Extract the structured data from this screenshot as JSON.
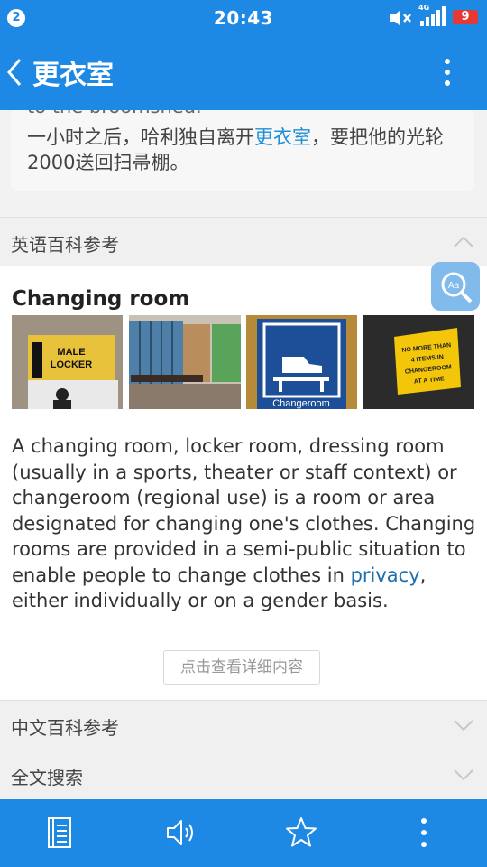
{
  "status_bar": {
    "notification_count": "2",
    "time": "20:43",
    "network": "4G",
    "battery": "9"
  },
  "header": {
    "title": "更衣室"
  },
  "example": {
    "cut_text": "to the broomshed.",
    "sentence_before": "一小时之后，哈利独自离开",
    "sentence_highlight": "更衣室",
    "sentence_after": "，要把他的光轮2000送回扫帚棚。"
  },
  "sections": {
    "english_encyclopedia": "英语百科参考",
    "chinese_encyclopedia": "中文百科参考",
    "full_text_search": "全文搜索"
  },
  "encyclopedia": {
    "heading": "Changing room",
    "images": [
      {
        "caption_line1": "MALE",
        "caption_line2": "LOCKER"
      },
      {
        "caption": ""
      },
      {
        "caption": "Changeroom"
      },
      {
        "caption": "NO MORE THAN 4 ITEMS IN CHANGEROOM AT A TIME"
      }
    ],
    "text_before_link": "A changing room, locker room, dressing room (usually in a sports, theater or staff context) or changeroom (regional use) is a room or area designated for changing one's clothes. Changing rooms are provided in a semi-public situation to enable people to change clothes in ",
    "link_text": "privacy",
    "text_after_link": ", either individually or on a gender basis.",
    "more_button": "点击查看详细内容"
  },
  "toolbar": {
    "icons": [
      "notebook-icon",
      "speaker-icon",
      "star-icon",
      "more-icon"
    ]
  },
  "colors": {
    "primary": "#1e88e5",
    "link": "#1e6fae",
    "highlight": "#1e8fd6",
    "battery_low": "#e53935"
  }
}
